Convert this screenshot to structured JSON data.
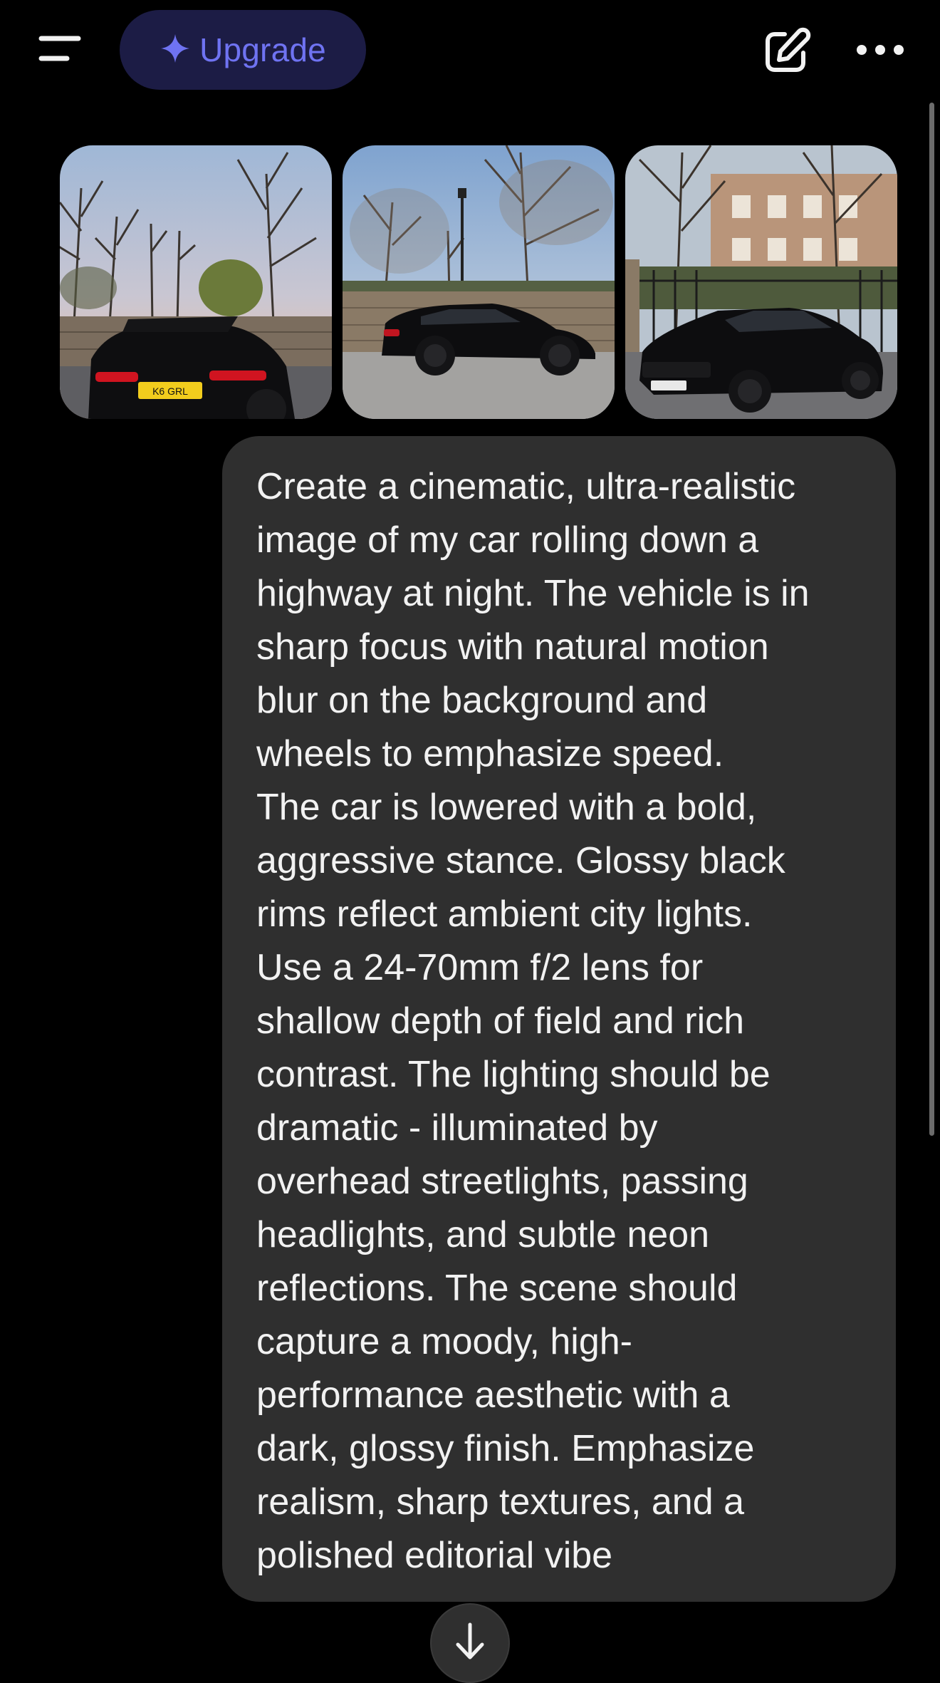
{
  "header": {
    "menu_icon": "menu-lines-icon",
    "upgrade_label": "Upgrade",
    "upgrade_icon": "sparkle-icon",
    "new_chat_icon": "edit-pencil-icon",
    "more_icon": "more-dots-icon",
    "accent_color": "#6f73f2",
    "upgrade_bg": "#1c1c45"
  },
  "attachments": {
    "images": [
      {
        "subject": "black hatchback rear view with yellow plate near bare trees"
      },
      {
        "subject": "black hatchback side view by stone wall and bare trees"
      },
      {
        "subject": "black hatchback front three-quarter view by iron fence and brick building"
      }
    ]
  },
  "message": {
    "role": "user",
    "text": "Create a cinematic, ultra-realistic\nimage of my car rolling down a\nhighway at night. The vehicle is in\nsharp focus with natural motion\nblur on the background and\nwheels to emphasize speed.\nThe car is lowered with a bold,\naggressive stance. Glossy black\nrims reflect ambient city lights.\nUse a 24-70mm f/2 lens for\nshallow depth of field and rich\ncontrast. The lighting should be\ndramatic - illuminated by\noverhead streetlights, passing\nheadlights, and subtle neon\nreflections. The scene should\ncapture a moody, high-\nperformance aesthetic with a\ndark, glossy finish. Emphasize\nrealism, sharp textures, and a\npolished editorial vibe",
    "bubble_color": "#2f2f2f"
  },
  "scroll_down": {
    "icon": "arrow-down-icon"
  }
}
